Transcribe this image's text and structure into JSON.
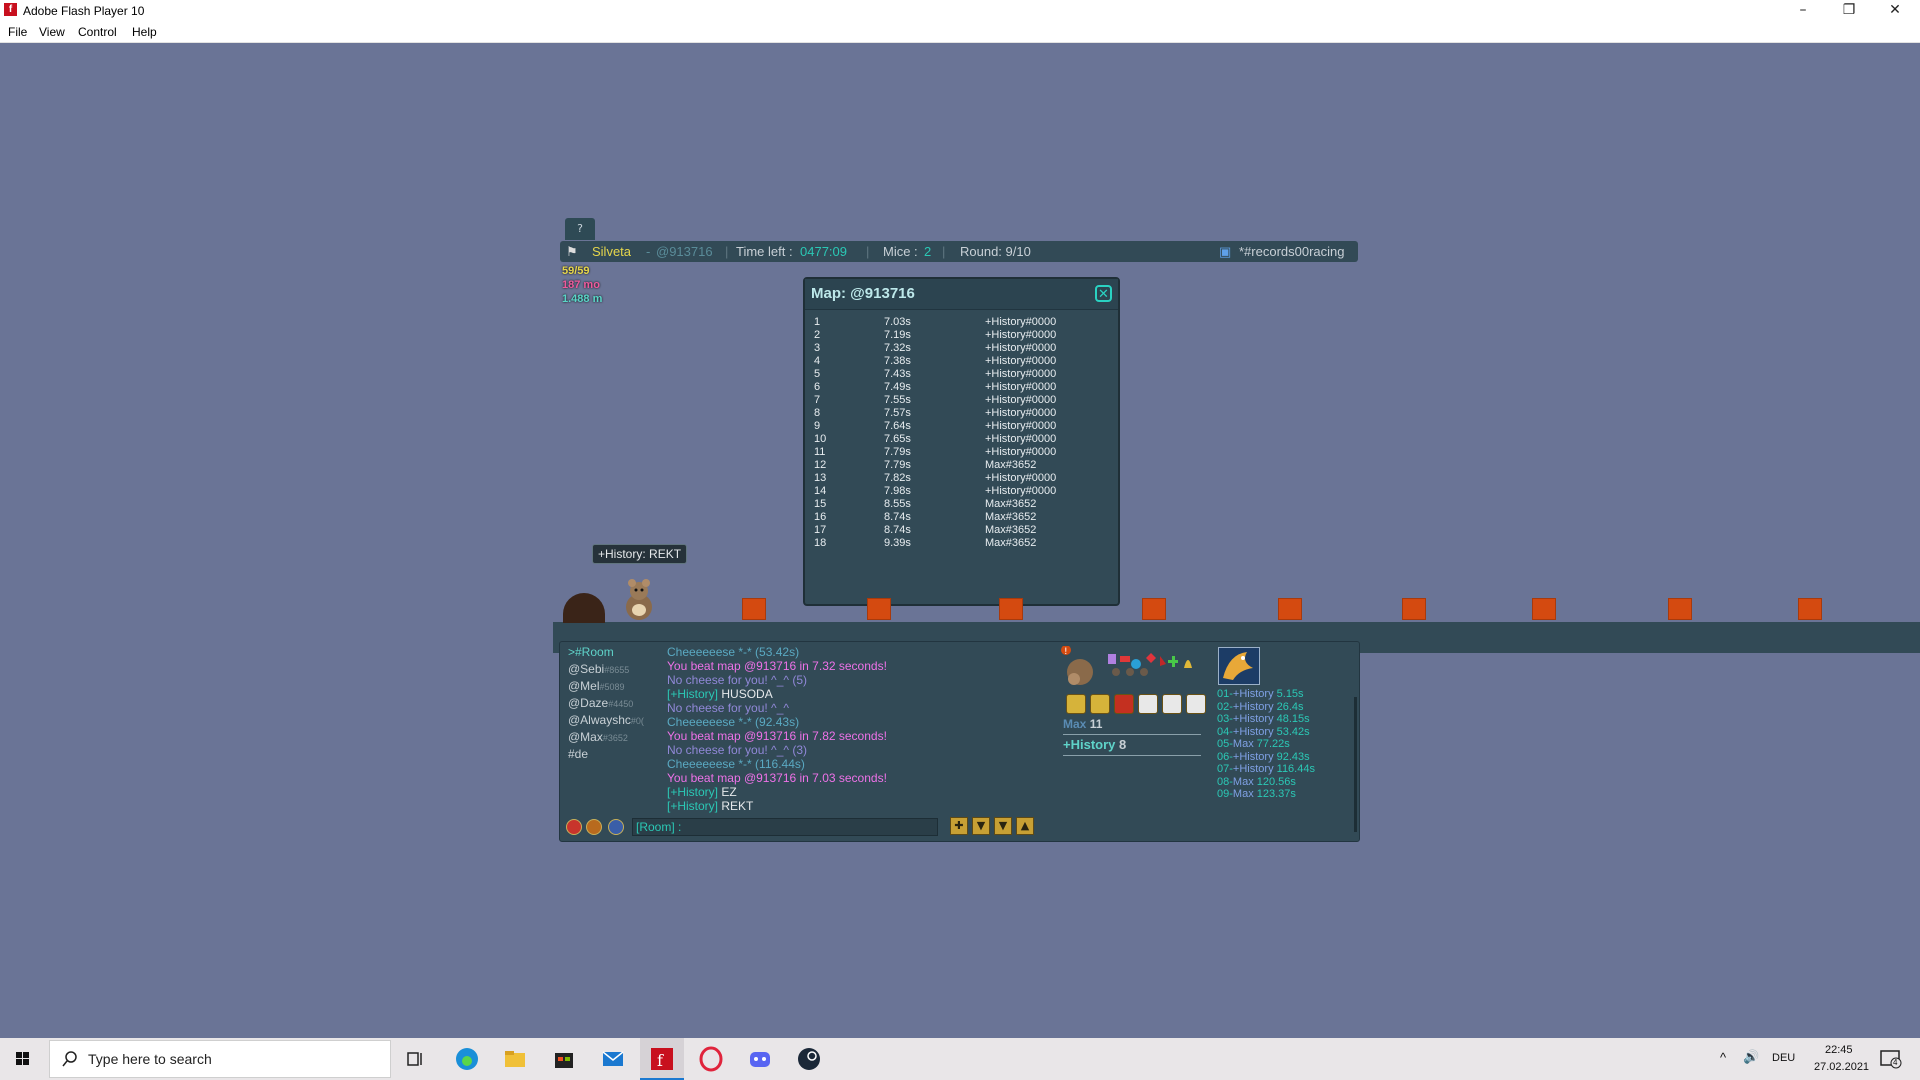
{
  "window": {
    "title": "Adobe Flash Player 10",
    "menu": [
      "File",
      "View",
      "Control",
      "Help"
    ]
  },
  "hud": {
    "help_label": "?",
    "player": "Silveta",
    "map_code": "@913716",
    "time_label": "Time left :",
    "time_value": "0477:09",
    "mice_label": "Mice :",
    "mice_value": "2",
    "round": "Round: 9/10",
    "room": "*#records00racing",
    "stats": [
      "59/59",
      "187 mo",
      "1.488 m"
    ]
  },
  "map_window": {
    "title": "Map: @913716",
    "records": [
      {
        "rank": "1",
        "time": "7.03s",
        "name": "+History#0000"
      },
      {
        "rank": "2",
        "time": "7.19s",
        "name": "+History#0000"
      },
      {
        "rank": "3",
        "time": "7.32s",
        "name": "+History#0000"
      },
      {
        "rank": "4",
        "time": "7.38s",
        "name": "+History#0000"
      },
      {
        "rank": "5",
        "time": "7.43s",
        "name": "+History#0000"
      },
      {
        "rank": "6",
        "time": "7.49s",
        "name": "+History#0000"
      },
      {
        "rank": "7",
        "time": "7.55s",
        "name": "+History#0000"
      },
      {
        "rank": "8",
        "time": "7.57s",
        "name": "+History#0000"
      },
      {
        "rank": "9",
        "time": "7.64s",
        "name": "+History#0000"
      },
      {
        "rank": "10",
        "time": "7.65s",
        "name": "+History#0000"
      },
      {
        "rank": "11",
        "time": "7.79s",
        "name": "+History#0000"
      },
      {
        "rank": "12",
        "time": "7.79s",
        "name": "Max#3652"
      },
      {
        "rank": "13",
        "time": "7.82s",
        "name": "+History#0000"
      },
      {
        "rank": "14",
        "time": "7.98s",
        "name": "+History#0000"
      },
      {
        "rank": "15",
        "time": "8.55s",
        "name": "Max#3652"
      },
      {
        "rank": "16",
        "time": "8.74s",
        "name": "Max#3652"
      },
      {
        "rank": "17",
        "time": "8.74s",
        "name": "Max#3652"
      },
      {
        "rank": "18",
        "time": "9.39s",
        "name": "Max#3652"
      }
    ]
  },
  "tooltip": {
    "name": "+History:",
    "text": "REKT"
  },
  "channels": [
    {
      "name": ">#Room",
      "tag": ""
    },
    {
      "name": "@Sebi",
      "tag": "#8655"
    },
    {
      "name": "@Mel",
      "tag": "#5089"
    },
    {
      "name": "@Daze",
      "tag": "#4450"
    },
    {
      "name": "@Alwayshc",
      "tag": "#0("
    },
    {
      "name": "@Max",
      "tag": "#3652"
    },
    {
      "name": "#de",
      "tag": ""
    }
  ],
  "chat": [
    {
      "type": "cc",
      "text": "Cheeeeeese *-* (53.42s)"
    },
    {
      "type": "bt",
      "text": "You beat map @913716 in 7.32 seconds!"
    },
    {
      "type": "nc",
      "text": "No cheese for you! ^_^ (5)"
    },
    {
      "type": "tr",
      "tag": "[+History]",
      "text": "HUSODA"
    },
    {
      "type": "nc",
      "text": "No cheese for you! ^_^"
    },
    {
      "type": "cc",
      "text": "Cheeeeeese *-* (92.43s)"
    },
    {
      "type": "bt",
      "text": "You beat map @913716 in 7.82 seconds!"
    },
    {
      "type": "nc",
      "text": "No cheese for you! ^_^ (3)"
    },
    {
      "type": "cc",
      "text": "Cheeeeeese *-* (116.44s)"
    },
    {
      "type": "bt",
      "text": "You beat map @913716 in 7.03 seconds!"
    },
    {
      "type": "tr",
      "tag": "[+History]",
      "text": "EZ"
    },
    {
      "type": "tr",
      "tag": "[+History]",
      "text": "REKT"
    }
  ],
  "chat_input": {
    "prefix": "[Room] :",
    "value": ""
  },
  "ranking": [
    {
      "name": "Max",
      "score": "11"
    },
    {
      "name": "+History",
      "score": "8"
    }
  ],
  "scoreboard": [
    {
      "idx": "01",
      "name": "+History",
      "time": "5.15s"
    },
    {
      "idx": "02",
      "name": "+History",
      "time": "26.4s"
    },
    {
      "idx": "03",
      "name": "+History",
      "time": "48.15s"
    },
    {
      "idx": "04",
      "name": "+History",
      "time": "53.42s"
    },
    {
      "idx": "05",
      "name": "Max",
      "time": "77.22s"
    },
    {
      "idx": "06",
      "name": "+History",
      "time": "92.43s"
    },
    {
      "idx": "07",
      "name": "+History",
      "time": "116.44s"
    },
    {
      "idx": "08",
      "name": "Max",
      "time": "120.56s"
    },
    {
      "idx": "09",
      "name": "Max",
      "time": "123.37s"
    }
  ],
  "taskbar": {
    "search_placeholder": "Type here to search",
    "language": "DEU",
    "time": "22:45",
    "date": "27.02.2021",
    "notifications": "4"
  },
  "colors": {
    "background": "#6a7496",
    "panel": "#324a56",
    "accent": "#2bc8b5",
    "block": "#d44a10"
  }
}
